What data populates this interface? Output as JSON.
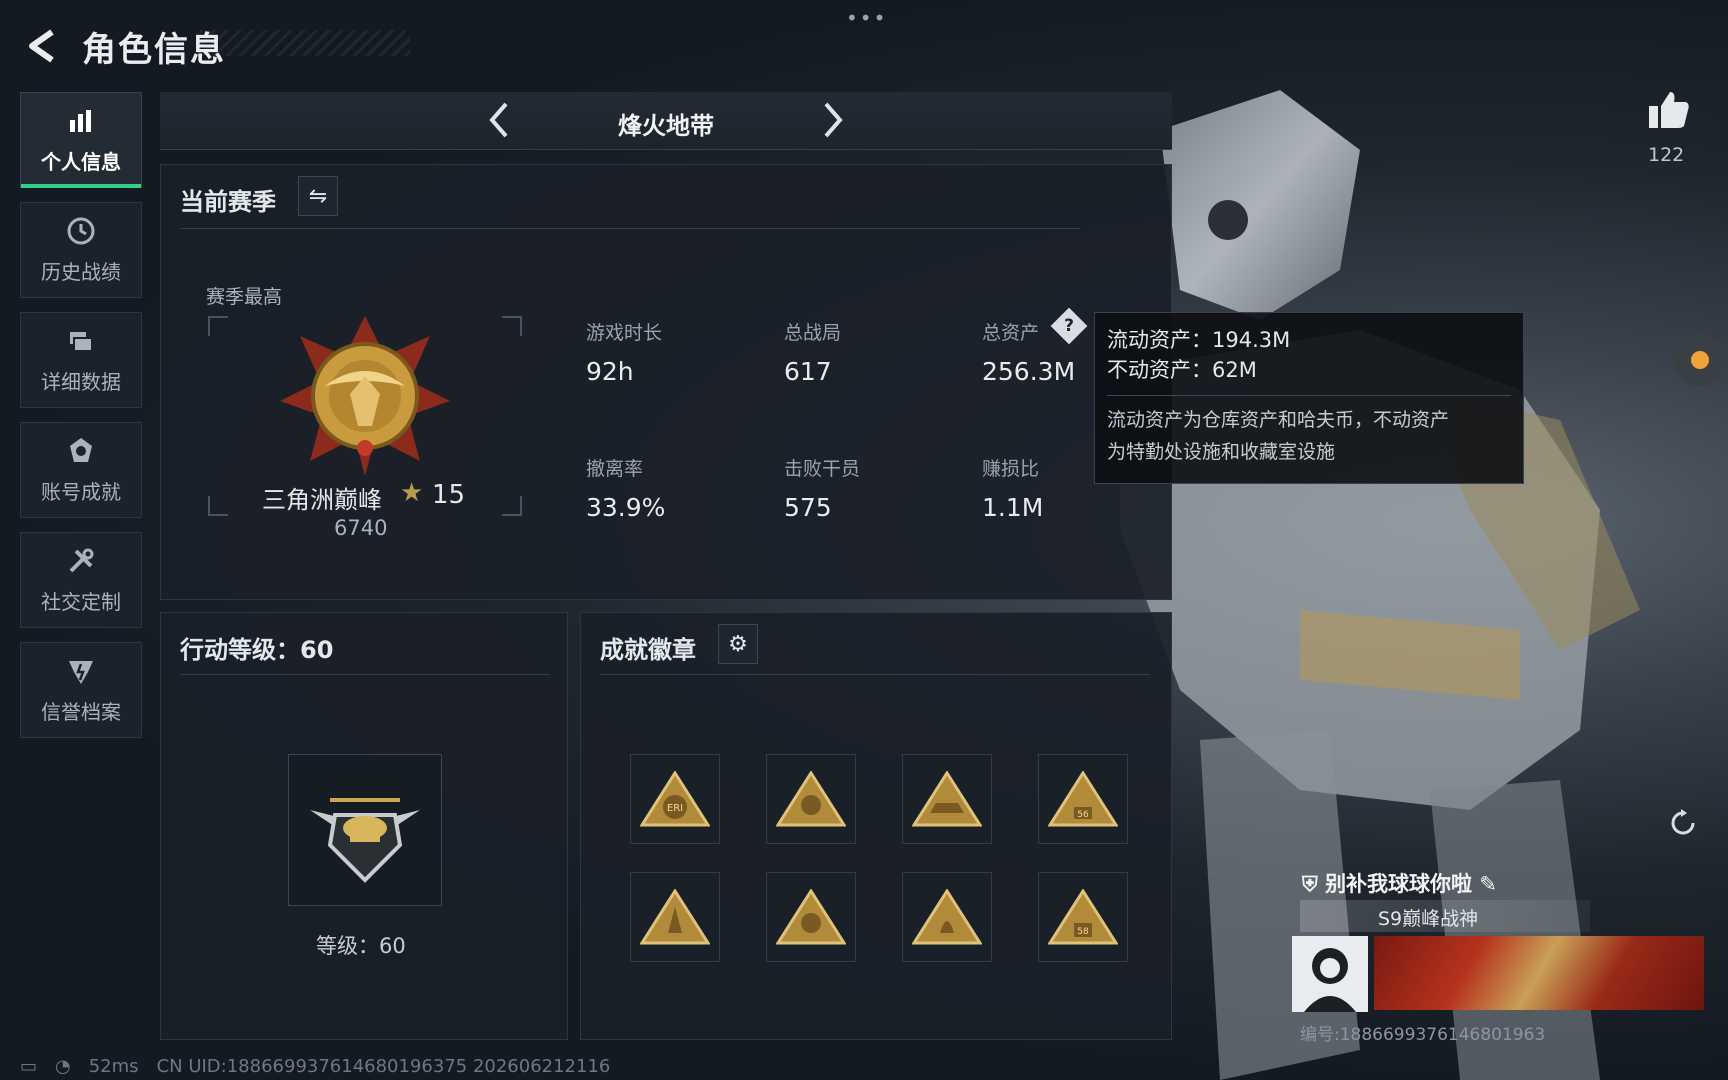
{
  "header": {
    "title": "角色信息"
  },
  "sidebar": {
    "items": [
      {
        "label": "个人信息",
        "icon": "bar-chart-icon",
        "active": true
      },
      {
        "label": "历史战绩",
        "icon": "history-clock-icon"
      },
      {
        "label": "详细数据",
        "icon": "folder-icon"
      },
      {
        "label": "账号成就",
        "icon": "achievement-badge-icon"
      },
      {
        "label": "社交定制",
        "icon": "tools-icon"
      },
      {
        "label": "信誉档案",
        "icon": "credit-shield-icon"
      }
    ]
  },
  "mode_tab": {
    "label": "烽火地带"
  },
  "season": {
    "title": "当前赛季",
    "best_label": "赛季最高",
    "rank_name": "三角洲巅峰",
    "rank_stars": "15",
    "rank_score": "6740",
    "stats": [
      {
        "label": "游戏时长",
        "value": "92h"
      },
      {
        "label": "总战局",
        "value": "617"
      },
      {
        "label": "总资产",
        "value": "256.3M"
      },
      {
        "label": "撤离率",
        "value": "33.9%"
      },
      {
        "label": "击败干员",
        "value": "575"
      },
      {
        "label": "赚损比",
        "value": "1.1M"
      }
    ]
  },
  "tooltip": {
    "liquid": "流动资产：194.3M",
    "fixed": "不动资产：62M",
    "desc_line1": "流动资产为仓库资产和哈夫币，不动资产",
    "desc_line2": "为特勤处设施和收藏室设施"
  },
  "action_level": {
    "title": "行动等级：60",
    "level_text": "等级：60"
  },
  "badges": {
    "title": "成就徽章",
    "items": [
      "ERI",
      "",
      "",
      "56",
      "",
      "",
      "",
      "58"
    ]
  },
  "likes": {
    "count": "122"
  },
  "player_card": {
    "name": "别补我球球你啦",
    "title": "S9巅峰战神",
    "id": "编号:1886699376146801963"
  },
  "footer": {
    "ping": "52ms",
    "uid": "CN UID:18866993761468019​6375 202606212116"
  },
  "colors": {
    "accent": "#2fd08a",
    "gold": "#b99a4c"
  }
}
